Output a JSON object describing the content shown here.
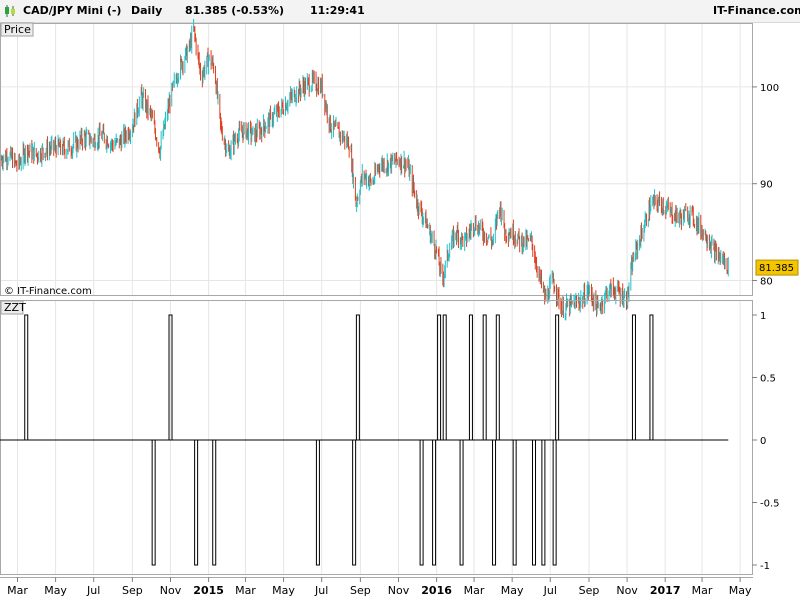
{
  "header": {
    "symbol": "CAD/JPY Mini (-)",
    "period": "Daily",
    "quote": "81.385 (-0.53%)",
    "time": "11:29:41",
    "brand": "IT-Finance.com"
  },
  "price_pane": {
    "label": "Price",
    "copyright": "© IT-Finance.com",
    "last_value": "81.385"
  },
  "zzt_pane": {
    "label": "ZZT"
  },
  "colors": {
    "up": "#20c0c8",
    "down": "#e04020",
    "grid": "#e6e6e6",
    "last_bg": "#f5c400"
  },
  "chart_data": [
    {
      "type": "candlestick",
      "title": "CAD/JPY Mini (-) Daily",
      "ylabel": "",
      "y_ticks": [
        80,
        90,
        100
      ],
      "ylim": [
        78.5,
        106.5
      ],
      "x_ticks": [
        "Mar",
        "May",
        "Jul",
        "Sep",
        "Nov",
        "2015",
        "Mar",
        "May",
        "Jul",
        "Sep",
        "Nov",
        "2016",
        "Mar",
        "May",
        "Jul",
        "Sep",
        "Nov",
        "2017",
        "Mar",
        "May"
      ],
      "close_path": [
        [
          "2014-02-01",
          92.5
        ],
        [
          "2014-02-15",
          93
        ],
        [
          "2014-03-01",
          91.8
        ],
        [
          "2014-03-15",
          93.5
        ],
        [
          "2014-04-01",
          93
        ],
        [
          "2014-04-15",
          93.5
        ],
        [
          "2014-05-01",
          93.8
        ],
        [
          "2014-05-15",
          93.6
        ],
        [
          "2014-06-01",
          94
        ],
        [
          "2014-06-15",
          94.8
        ],
        [
          "2014-07-01",
          94.5
        ],
        [
          "2014-07-15",
          95
        ],
        [
          "2014-08-01",
          94
        ],
        [
          "2014-08-15",
          94.5
        ],
        [
          "2014-09-01",
          96
        ],
        [
          "2014-09-15",
          99
        ],
        [
          "2014-10-01",
          97
        ],
        [
          "2014-10-15",
          93.5
        ],
        [
          "2014-11-01",
          99
        ],
        [
          "2014-11-15",
          102
        ],
        [
          "2014-12-01",
          104
        ],
        [
          "2014-12-08",
          106
        ],
        [
          "2014-12-20",
          101
        ],
        [
          "2015-01-01",
          103
        ],
        [
          "2015-01-10",
          102
        ],
        [
          "2015-01-20",
          96
        ],
        [
          "2015-02-01",
          93
        ],
        [
          "2015-02-15",
          95
        ],
        [
          "2015-03-01",
          95.5
        ],
        [
          "2015-03-15",
          95
        ],
        [
          "2015-04-01",
          96
        ],
        [
          "2015-04-15",
          97
        ],
        [
          "2015-05-01",
          98
        ],
        [
          "2015-05-15",
          99
        ],
        [
          "2015-06-01",
          100
        ],
        [
          "2015-06-15",
          100.5
        ],
        [
          "2015-07-01",
          100
        ],
        [
          "2015-07-15",
          96
        ],
        [
          "2015-08-01",
          95
        ],
        [
          "2015-08-15",
          94
        ],
        [
          "2015-08-25",
          88
        ],
        [
          "2015-09-05",
          91
        ],
        [
          "2015-09-20",
          90
        ],
        [
          "2015-10-01",
          92
        ],
        [
          "2015-10-15",
          92
        ],
        [
          "2015-11-01",
          92.5
        ],
        [
          "2015-11-15",
          92
        ],
        [
          "2015-12-01",
          88
        ],
        [
          "2015-12-15",
          86
        ],
        [
          "2016-01-01",
          83
        ],
        [
          "2016-01-10",
          80
        ],
        [
          "2016-01-20",
          83
        ],
        [
          "2016-02-01",
          85
        ],
        [
          "2016-02-15",
          84
        ],
        [
          "2016-03-01",
          86
        ],
        [
          "2016-03-15",
          85
        ],
        [
          "2016-04-01",
          84
        ],
        [
          "2016-04-10",
          88
        ],
        [
          "2016-04-20",
          85
        ],
        [
          "2016-05-01",
          85
        ],
        [
          "2016-05-15",
          84
        ],
        [
          "2016-06-01",
          84
        ],
        [
          "2016-06-15",
          80
        ],
        [
          "2016-06-24",
          78
        ],
        [
          "2016-07-05",
          80
        ],
        [
          "2016-07-20",
          77
        ],
        [
          "2016-08-05",
          77.5
        ],
        [
          "2016-08-20",
          78
        ],
        [
          "2016-09-01",
          79
        ],
        [
          "2016-09-15",
          77
        ],
        [
          "2016-10-01",
          79
        ],
        [
          "2016-10-15",
          79
        ],
        [
          "2016-11-01",
          78
        ],
        [
          "2016-11-10",
          82
        ],
        [
          "2016-11-25",
          85
        ],
        [
          "2016-12-10",
          88
        ],
        [
          "2016-12-25",
          88
        ],
        [
          "2017-01-10",
          87
        ],
        [
          "2017-01-25",
          86.5
        ],
        [
          "2017-02-10",
          87
        ],
        [
          "2017-02-25",
          85.5
        ],
        [
          "2017-03-10",
          84.5
        ],
        [
          "2017-03-20",
          83
        ],
        [
          "2017-04-05",
          82
        ],
        [
          "2017-04-12",
          81.385
        ]
      ],
      "last": 81.385
    },
    {
      "type": "line",
      "title": "ZZT",
      "y_ticks": [
        1,
        0.5,
        0,
        -0.5,
        -1
      ],
      "y_tick_labels": [
        "1",
        "0.5",
        "0",
        "-0.5",
        "-1"
      ],
      "ylim": [
        -1,
        1
      ],
      "signals": [
        {
          "date": "2014-03-15",
          "value": 1
        },
        {
          "date": "2014-10-05",
          "value": -1
        },
        {
          "date": "2014-11-01",
          "value": 1
        },
        {
          "date": "2014-12-12",
          "value": -1
        },
        {
          "date": "2015-01-10",
          "value": -1
        },
        {
          "date": "2015-06-25",
          "value": -1
        },
        {
          "date": "2015-08-22",
          "value": -1
        },
        {
          "date": "2015-08-28",
          "value": 1
        },
        {
          "date": "2015-12-08",
          "value": -1
        },
        {
          "date": "2015-12-28",
          "value": -1
        },
        {
          "date": "2016-01-05",
          "value": 1
        },
        {
          "date": "2016-01-14",
          "value": 1
        },
        {
          "date": "2016-02-10",
          "value": -1
        },
        {
          "date": "2016-02-25",
          "value": 1
        },
        {
          "date": "2016-03-18",
          "value": 1
        },
        {
          "date": "2016-04-02",
          "value": -1
        },
        {
          "date": "2016-04-08",
          "value": 1
        },
        {
          "date": "2016-05-05",
          "value": -1
        },
        {
          "date": "2016-06-05",
          "value": -1
        },
        {
          "date": "2016-06-20",
          "value": -1
        },
        {
          "date": "2016-07-08",
          "value": -1
        },
        {
          "date": "2016-07-12",
          "value": 1
        },
        {
          "date": "2016-11-12",
          "value": 1
        },
        {
          "date": "2016-12-10",
          "value": 1
        }
      ]
    }
  ]
}
